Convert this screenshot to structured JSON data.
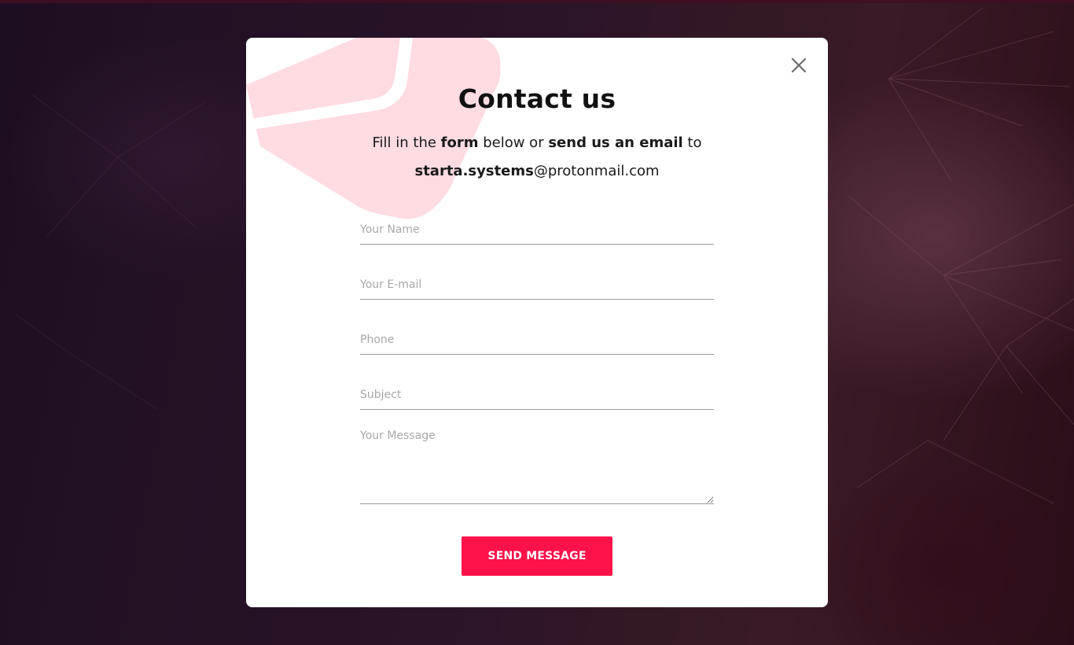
{
  "modal": {
    "title": "Contact us",
    "subtitle": {
      "part1": "Fill in the ",
      "bold1": "form",
      "part2": " below or ",
      "bold2": "send us an email",
      "part3": " to",
      "email_bold": "starta.systems",
      "email_rest": "@protonmail.com"
    },
    "close_icon": "close-icon",
    "decoration_icon": "envelope-icon"
  },
  "form": {
    "name_placeholder": "Your Name",
    "email_placeholder": "Your E-mail",
    "phone_placeholder": "Phone",
    "subject_placeholder": "Subject",
    "message_placeholder": "Your Message",
    "submit_label": "SEND MESSAGE"
  },
  "colors": {
    "accent": "#ff1149",
    "envelope_tint": "#ffdbe2",
    "close_icon": "#6b6b6b"
  }
}
